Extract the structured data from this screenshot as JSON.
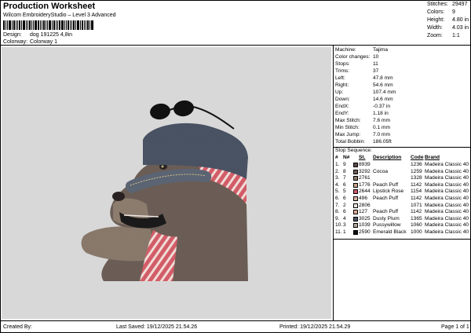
{
  "header": {
    "title": "Production Worksheet",
    "subtitle": "Wilcom EmbroideryStudio – Level 3 Advanced",
    "design_label": "Design:",
    "design_value": "dog 191225 4,8in",
    "colorway_label": "Colorway:",
    "colorway_value": "Colorway 1",
    "stats": [
      {
        "label": "Stitches:",
        "value": "29497"
      },
      {
        "label": "Colors:",
        "value": "9"
      },
      {
        "label": "Height:",
        "value": "4.80 in"
      },
      {
        "label": "Width:",
        "value": "4.03 in"
      },
      {
        "label": "Zoom:",
        "value": "1:1"
      }
    ]
  },
  "machine_info": [
    {
      "label": "Machine:",
      "value": "Tajima"
    },
    {
      "label": "Color changes:",
      "value": "10"
    },
    {
      "label": "Stops:",
      "value": "11"
    },
    {
      "label": "Trims:",
      "value": "37"
    },
    {
      "label": "Left:",
      "value": "47.8 mm"
    },
    {
      "label": "Right:",
      "value": "54.6 mm"
    },
    {
      "label": "Up:",
      "value": "107.4 mm"
    },
    {
      "label": "Down:",
      "value": "14.6 mm"
    },
    {
      "label": "EndX:",
      "value": "-0.37 in"
    },
    {
      "label": "EndY:",
      "value": "1.18 in"
    },
    {
      "label": "Max Stitch:",
      "value": "7.6 mm"
    },
    {
      "label": "Min Stitch:",
      "value": "0.1 mm"
    },
    {
      "label": "Max Jump:",
      "value": "7.0 mm"
    },
    {
      "label": "Total Bobbin:",
      "value": "186.05ft"
    }
  ],
  "stop_sequence": {
    "title": "Stop Sequence:",
    "headers": {
      "idx": "#",
      "n": "N#",
      "st": "St.",
      "desc": "Description",
      "code": "Code",
      "brand": "Brand"
    },
    "rows": [
      {
        "idx": "1.",
        "n": "9",
        "color": "#5b4a48",
        "st": "8939",
        "desc": "",
        "code": "1236",
        "brand": "Madeira Classic 40"
      },
      {
        "idx": "2.",
        "n": "8",
        "color": "#6e6058",
        "st": "3292",
        "desc": "Cocoa",
        "code": "1259",
        "brand": "Madeira Classic 40"
      },
      {
        "idx": "3.",
        "n": "7",
        "color": "#8c7c6e",
        "st": "2761",
        "desc": "",
        "code": "1328",
        "brand": "Madeira Classic 40"
      },
      {
        "idx": "4.",
        "n": "6",
        "color": "#c7a38e",
        "st": "1776",
        "desc": "Peach Puff",
        "code": "1142",
        "brand": "Madeira Classic 40"
      },
      {
        "idx": "5.",
        "n": "5",
        "color": "#d2566a",
        "st": "2644",
        "desc": "Lipstick Rose",
        "code": "1154",
        "brand": "Madeira Classic 40"
      },
      {
        "idx": "6.",
        "n": "6",
        "color": "#d8b2a2",
        "st": "496",
        "desc": "Peach Puff",
        "code": "1142",
        "brand": "Madeira Classic 40"
      },
      {
        "idx": "7.",
        "n": "2",
        "color": "#efe6e2",
        "st": "2806",
        "desc": "",
        "code": "1071",
        "brand": "Madeira Classic 40"
      },
      {
        "idx": "8.",
        "n": "6",
        "color": "#d8ac98",
        "st": "127",
        "desc": "Peach Puff",
        "code": "1142",
        "brand": "Madeira Classic 40"
      },
      {
        "idx": "9.",
        "n": "4",
        "color": "#4b5566",
        "st": "3025",
        "desc": "Dusty Plum",
        "code": "1365",
        "brand": "Madeira Classic 40"
      },
      {
        "idx": "10.",
        "n": "3",
        "color": "#b0a99e",
        "st": "1039",
        "desc": "Pussywillow",
        "code": "1060",
        "brand": "Madeira Classic 40"
      },
      {
        "idx": "11.",
        "n": "1",
        "color": "#111111",
        "st": "2590",
        "desc": "Emerald Black",
        "code": "1000",
        "brand": "Madeira Classic 40"
      }
    ]
  },
  "footer": {
    "created_by": "Created By:",
    "last_saved": "Last Saved: 19/12/2025 21.54.26",
    "printed": "Printed: 19/12/2025 21.54.29",
    "page": "Page 1 of 1"
  }
}
